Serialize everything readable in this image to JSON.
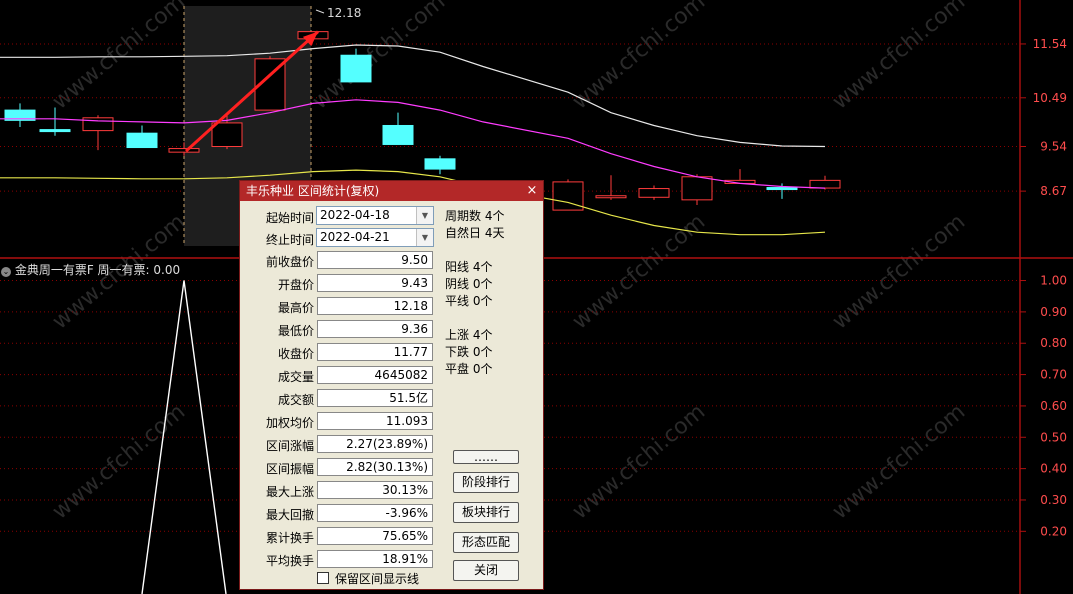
{
  "chart_data": {
    "type": "candlestick",
    "price_axis_labels": [
      "11.54",
      "10.49",
      "9.54",
      "8.67"
    ],
    "indicator_axis_labels": [
      "1.00",
      "0.90",
      "0.80",
      "0.70",
      "0.60",
      "0.50",
      "0.40",
      "0.30",
      "0.20"
    ],
    "high_marker": "12.18",
    "candles": [
      {
        "o": 10.25,
        "c": 10.05,
        "h": 10.38,
        "l": 9.92,
        "up": false
      },
      {
        "o": 9.87,
        "c": 9.87,
        "h": 10.3,
        "l": 9.75,
        "up": false
      },
      {
        "o": 10.1,
        "c": 9.85,
        "h": 10.15,
        "l": 9.47,
        "up": true
      },
      {
        "o": 9.8,
        "c": 9.52,
        "h": 9.95,
        "l": 9.52,
        "up": false
      },
      {
        "o": 9.5,
        "c": 9.43,
        "h": 9.62,
        "l": 9.36,
        "up": true
      },
      {
        "o": 9.54,
        "c": 10.0,
        "h": 10.2,
        "l": 9.49,
        "up": true
      },
      {
        "o": 10.25,
        "c": 11.25,
        "h": 11.3,
        "l": 10.25,
        "up": true
      },
      {
        "o": 11.64,
        "c": 11.78,
        "h": 11.78,
        "l": 11.64,
        "up": true
      },
      {
        "o": 11.32,
        "c": 10.8,
        "h": 11.45,
        "l": 10.8,
        "up": false
      },
      {
        "o": 9.95,
        "c": 9.58,
        "h": 10.2,
        "l": 9.58,
        "up": false
      },
      {
        "o": 9.3,
        "c": 9.1,
        "h": 9.36,
        "l": 9.0,
        "up": false
      },
      {
        "o": 8.0,
        "c": 8.2,
        "h": 8.3,
        "l": 7.9,
        "up": true
      },
      {
        "o": 8.3,
        "c": 8.85,
        "h": 8.9,
        "l": 8.3,
        "up": true
      },
      {
        "o": 8.55,
        "c": 8.58,
        "h": 8.98,
        "l": 8.5,
        "up": true
      },
      {
        "o": 8.55,
        "c": 8.72,
        "h": 8.78,
        "l": 8.5,
        "up": true
      },
      {
        "o": 8.5,
        "c": 8.95,
        "h": 9.0,
        "l": 8.4,
        "up": true
      },
      {
        "o": 8.82,
        "c": 8.88,
        "h": 9.1,
        "l": 8.82,
        "up": true
      },
      {
        "o": 8.74,
        "c": 8.72,
        "h": 8.82,
        "l": 8.52,
        "up": false
      },
      {
        "o": 8.73,
        "c": 8.88,
        "h": 8.97,
        "l": 8.7,
        "up": true
      }
    ],
    "ma_white": [
      11.28,
      11.28,
      11.29,
      11.29,
      11.3,
      11.31,
      11.36,
      11.45,
      11.52,
      11.5,
      11.38,
      11.1,
      10.6,
      10.2,
      9.95,
      9.75,
      9.62,
      9.55,
      9.54
    ],
    "ma_magenta": [
      10.08,
      10.08,
      10.04,
      10.02,
      10.0,
      10.05,
      10.2,
      10.38,
      10.45,
      10.4,
      10.25,
      10.02,
      9.7,
      9.4,
      9.15,
      8.95,
      8.82,
      8.76,
      8.73
    ],
    "ma_yellow": [
      8.93,
      8.93,
      8.92,
      8.91,
      8.91,
      8.93,
      8.98,
      9.05,
      9.08,
      9.05,
      8.95,
      8.75,
      8.45,
      8.2,
      8.0,
      7.87,
      7.82,
      7.82,
      7.87
    ],
    "ylim": [
      7.6,
      12.28
    ],
    "indicator": {
      "ylim": [
        0.0,
        1.04
      ],
      "peak": 1.0
    }
  },
  "indicator_title": "金典周一有票F 周一有票: 0.00",
  "dialog": {
    "title": "丰乐种业 区间统计(复权)",
    "close": "×",
    "start_label": "起始时间",
    "start_value": "2022-04-18",
    "end_label": "终止时间",
    "end_value": "2022-04-21",
    "fields": [
      {
        "label": "前收盘价",
        "value": "9.50"
      },
      {
        "label": "开盘价",
        "value": "9.43"
      },
      {
        "label": "最高价",
        "value": "12.18"
      },
      {
        "label": "最低价",
        "value": "9.36"
      },
      {
        "label": "收盘价",
        "value": "11.77"
      },
      {
        "label": "成交量",
        "value": "4645082"
      },
      {
        "label": "成交额",
        "value": "51.5亿"
      },
      {
        "label": "加权均价",
        "value": "11.093"
      },
      {
        "label": "区间涨幅",
        "value": "2.27(23.89%)"
      },
      {
        "label": "区间振幅",
        "value": "2.82(30.13%)"
      },
      {
        "label": "最大上涨",
        "value": "30.13%"
      },
      {
        "label": "最大回撤",
        "value": "-3.96%"
      },
      {
        "label": "累计换手",
        "value": "75.65%"
      },
      {
        "label": "平均换手",
        "value": "18.91%"
      }
    ],
    "stats": [
      "周期数 4个",
      "自然日 4天",
      "阳线 4个",
      "阴线 0个",
      "平线 0个",
      "上涨 4个",
      "下跌 0个",
      "平盘 0个"
    ],
    "buttons": [
      "……",
      "阶段排行",
      "板块排行",
      "形态匹配",
      "关闭"
    ],
    "checkbox_label": "保留区间显示线"
  },
  "watermark": "www.cfchi.com",
  "colors": {
    "up": "#ff3c3c",
    "down": "#54ffff",
    "grid": "#8b0000",
    "axis_text": "#ff4d4d",
    "ma_white": "#e8e8e8",
    "ma_magenta": "#ff3cff",
    "ma_yellow": "#e6e64a"
  }
}
